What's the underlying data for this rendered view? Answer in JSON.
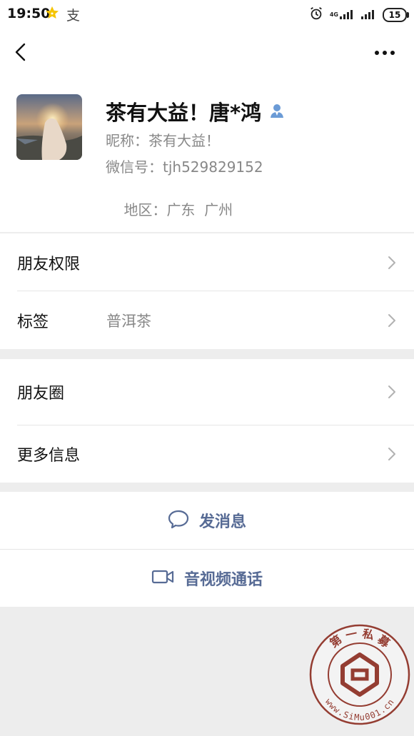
{
  "status_bar": {
    "time": "19:50",
    "zhi_glyph": "支",
    "network": "4G",
    "battery": "15"
  },
  "profile": {
    "name": "茶有大益！唐*鸿",
    "nickname_label": "昵称：",
    "nickname": "茶有大益！",
    "wechat_id_label": "微信号：",
    "wechat_id": "tjh529829152",
    "region_label": "地区：",
    "region": "广东  广州"
  },
  "rows": {
    "friend_permissions": "朋友权限",
    "tags_label": "标签",
    "tags_value": "普洱茶",
    "moments": "朋友圈",
    "more_info": "更多信息"
  },
  "actions": {
    "send_message": "发消息",
    "video_call": "音视频通话"
  },
  "watermark": {
    "text_top": "第 一 私 募",
    "text_bottom": "www.SiMu001.cn"
  },
  "icons": [
    "back-icon",
    "more-icon",
    "verified-user-icon",
    "chevron-right-icon",
    "chat-bubble-icon",
    "video-camera-icon",
    "alarm-icon",
    "signal-icon",
    "star-icon"
  ],
  "colors": {
    "accent": "#576b95",
    "secondary_text": "#888888",
    "background": "#ededed",
    "verified": "#6b9bd6",
    "watermark": "#8b2a1e"
  }
}
